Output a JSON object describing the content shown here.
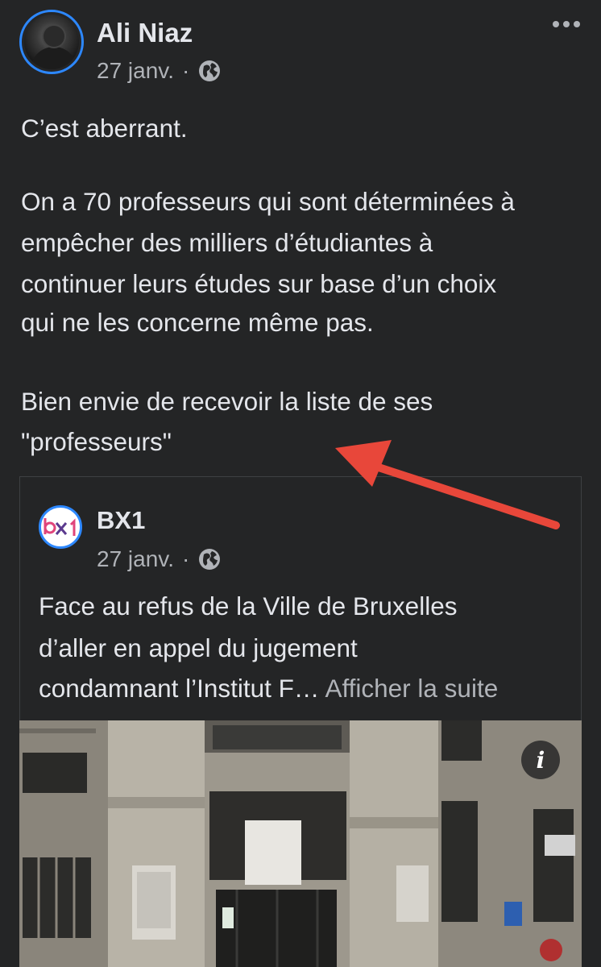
{
  "post": {
    "author": "Ali Niaz",
    "date": "27 janv.",
    "separator": "·",
    "privacy_icon": "globe-icon",
    "menu_icon": "more-options-icon",
    "text_lines": [
      "C’est aberrant.",
      "On a 70 professeurs qui sont déterminées à",
      "empêcher des milliers d’étudiantes à",
      "continuer leurs études sur base d’un choix",
      "qui ne les concerne même pas.",
      "Bien envie de recevoir la liste de ses",
      "\"professeurs\""
    ]
  },
  "shared": {
    "page_name": "BX1",
    "date": "27 janv.",
    "separator": "·",
    "logo_text": "bx1",
    "text_lines": [
      "Face au refus de la Ville de Bruxelles",
      "d’aller en appel du jugement",
      "condamnant l’Institut F…"
    ],
    "see_more": "Afficher la suite",
    "info_label": "i"
  },
  "colors": {
    "background": "#242526",
    "text_primary": "#e4e6eb",
    "text_secondary": "#b0b3b8",
    "avatar_ring": "#2d88ff",
    "annotation_arrow": "#e8473a"
  }
}
